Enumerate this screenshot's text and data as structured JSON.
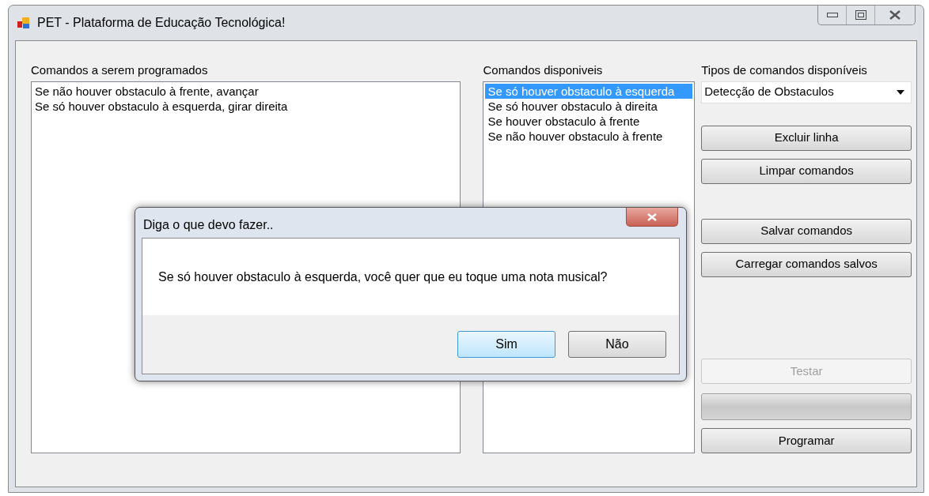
{
  "window": {
    "title": "PET - Plataforma de Educação Tecnológica!"
  },
  "program_panel": {
    "label": "Comandos a serem programados",
    "items": [
      "Se não houver obstaculo à frente, avançar",
      "Se só houver obstaculo à esquerda, girar direita"
    ]
  },
  "available_panel": {
    "label": "Comandos disponiveis",
    "items": [
      {
        "text": "Se só houver obstaculo à esquerda",
        "selected": true
      },
      {
        "text": "Se só houver obstaculo à direita",
        "selected": false
      },
      {
        "text": "Se houver obstaculo à frente",
        "selected": false
      },
      {
        "text": "Se não houver obstaculo à frente",
        "selected": false
      }
    ]
  },
  "types": {
    "label": "Tipos de comandos disponíveis",
    "value": "Detecção de Obstaculos"
  },
  "actions_top": [
    {
      "label": "Excluir linha",
      "disabled": false
    },
    {
      "label": "Limpar comandos",
      "disabled": false
    }
  ],
  "actions_middle": [
    {
      "label": "Salvar comandos",
      "disabled": false
    },
    {
      "label": "Carregar comandos salvos",
      "disabled": false
    }
  ],
  "test_button": {
    "label": "Testar",
    "disabled": true
  },
  "progress": {
    "level": 0
  },
  "program_button": {
    "label": "Programar",
    "disabled": false
  },
  "dialog": {
    "title": "Diga o que devo fazer..",
    "message": "Se só houver obstaculo à esquerda, você quer que eu toque uma nota musical?",
    "buttons": [
      {
        "label": "Sim",
        "focused": true
      },
      {
        "label": "Não",
        "focused": false
      }
    ]
  }
}
